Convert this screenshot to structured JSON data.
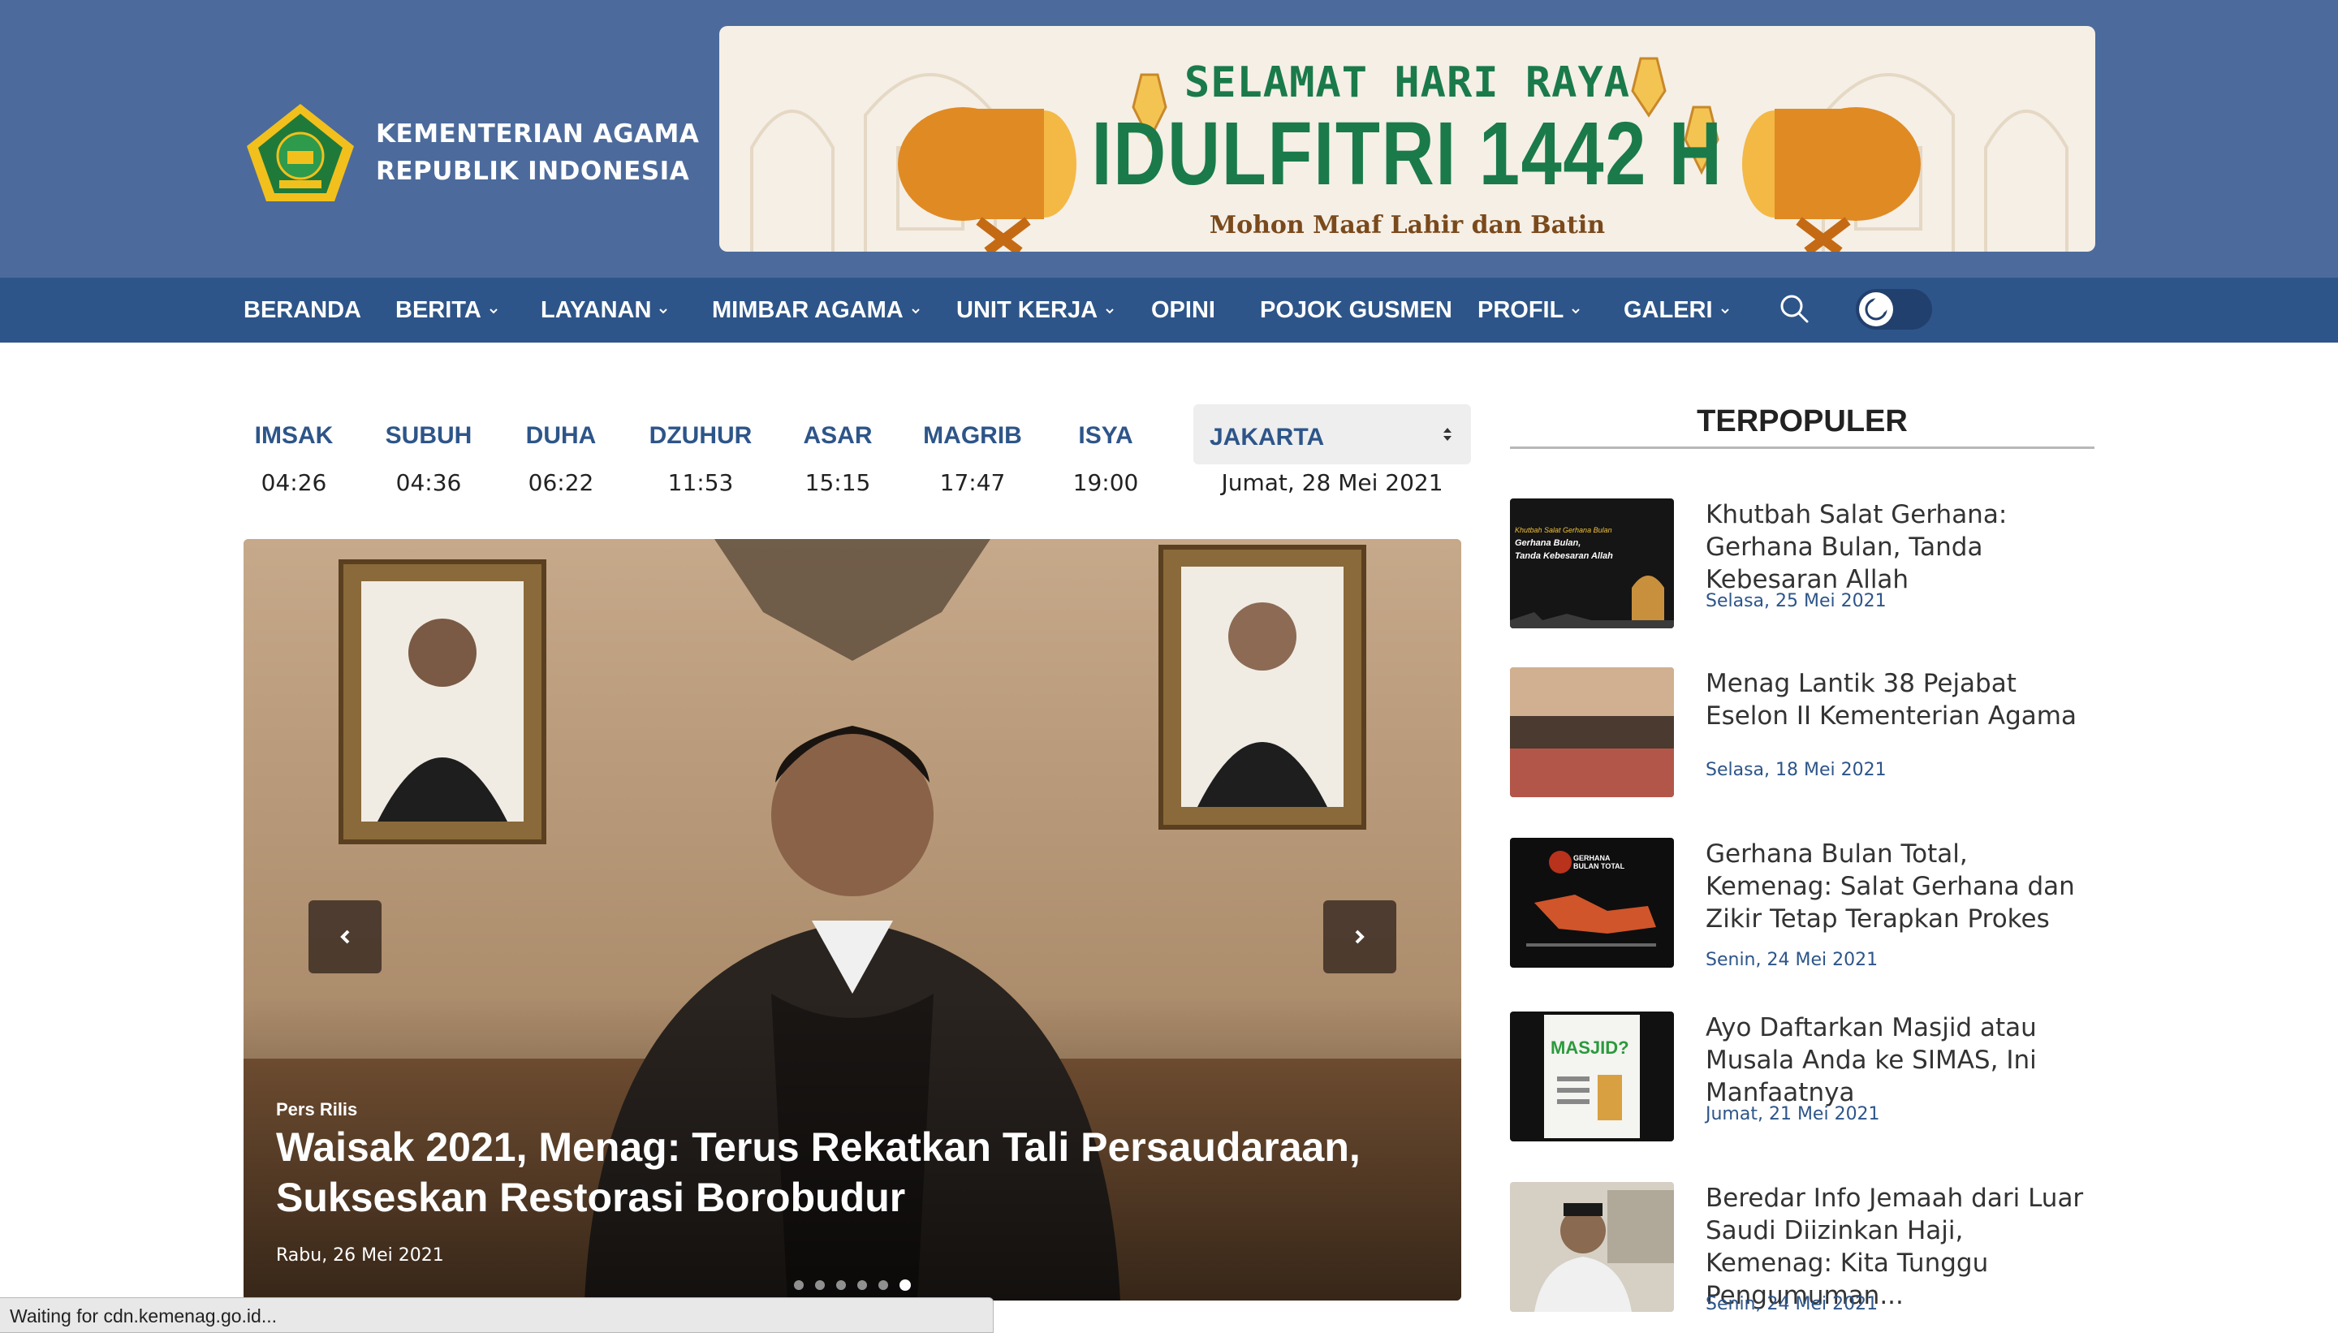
{
  "header": {
    "brand_line1": "KEMENTERIAN AGAMA",
    "brand_line2": "REPUBLIK INDONESIA",
    "logo_icon": "kemenag-emblem-icon",
    "banner": {
      "line1": "SELAMAT HARI RAYA",
      "line2": "IDULFITRI 1442 H",
      "line3": "Mohon Maaf Lahir dan Batin"
    }
  },
  "nav": {
    "items": [
      {
        "label": "BERANDA",
        "dropdown": false
      },
      {
        "label": "BERITA",
        "dropdown": true
      },
      {
        "label": "LAYANAN",
        "dropdown": true
      },
      {
        "label": "MIMBAR AGAMA",
        "dropdown": true
      },
      {
        "label": "UNIT KERJA",
        "dropdown": true
      },
      {
        "label": "OPINI",
        "dropdown": false
      },
      {
        "label": "POJOK GUSMEN",
        "dropdown": false
      },
      {
        "label": "PROFIL",
        "dropdown": true
      },
      {
        "label": "GALERI",
        "dropdown": true
      }
    ],
    "search_icon": "search-icon",
    "theme_toggle_icon": "moon-icon"
  },
  "prayer_times": [
    {
      "name": "IMSAK",
      "time": "04:26"
    },
    {
      "name": "SUBUH",
      "time": "04:36"
    },
    {
      "name": "DUHA",
      "time": "06:22"
    },
    {
      "name": "DZUHUR",
      "time": "11:53"
    },
    {
      "name": "ASAR",
      "time": "15:15"
    },
    {
      "name": "MAGRIB",
      "time": "17:47"
    },
    {
      "name": "ISYA",
      "time": "19:00"
    }
  ],
  "city": {
    "selected": "JAKARTA",
    "date": "Jumat, 28 Mei 2021"
  },
  "slider": {
    "category": "Pers Rilis",
    "title": "Waisak 2021, Menag: Terus Rekatkan Tali Persaudaraan, Sukseskan Restorasi Borobudur",
    "date": "Rabu, 26 Mei 2021",
    "dot_count": 6,
    "active_dot": 6
  },
  "sidebar": {
    "title": "TERPOPULER",
    "items": [
      {
        "title": "Khutbah Salat Gerhana: Gerhana Bulan, Tanda Kebesaran Allah",
        "date": "Selasa, 25 Mei 2021",
        "thumb_text": "Khutbah Salat Gerhana Bulan\nGerhana Bulan,\nTanda Kebesaran Allah"
      },
      {
        "title": "Menag Lantik 38 Pejabat Eselon II Kementerian Agama",
        "date": "Selasa, 18 Mei 2021"
      },
      {
        "title": "Gerhana Bulan Total, Kemenag: Salat Gerhana dan Zikir Tetap Terapkan Prokes",
        "date": "Senin, 24 Mei 2021",
        "thumb_text": "GERHANA BULAN TOTAL"
      },
      {
        "title": "Ayo Daftarkan Masjid atau Musala Anda ke SIMAS, Ini Manfaatnya",
        "date": "Jumat, 21 Mei 2021",
        "thumb_text": "MASJID?"
      },
      {
        "title": "Beredar Info Jemaah dari Luar Saudi Diizinkan Haji, Kemenag: Kita Tunggu Pengumuman...",
        "date": "Senin, 24 Mei 2021"
      }
    ]
  },
  "status_bar": "Waiting for cdn.kemenag.go.id..."
}
